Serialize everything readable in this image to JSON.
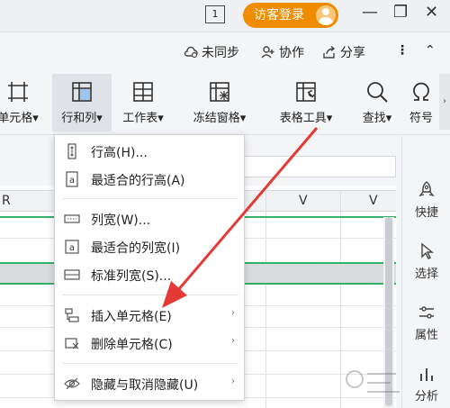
{
  "titlebar": {
    "box_label": "1",
    "visitor_label": "访客登录",
    "minimize": "—",
    "restore": "❐",
    "close": "✕"
  },
  "collab": {
    "sync_label": "未同步",
    "collab_label": "协作",
    "share_label": "分享",
    "more": "⋮",
    "collapse": "⌃"
  },
  "ribbon": {
    "items": [
      {
        "label": "单元格"
      },
      {
        "label": "行和列"
      },
      {
        "label": "工作表"
      },
      {
        "label": "冻结窗格"
      },
      {
        "label": "表格工具"
      },
      {
        "label": "查找"
      },
      {
        "label": "符号"
      }
    ],
    "scroll_right": "›"
  },
  "sheet": {
    "col_headers": [
      "R",
      "V",
      "V"
    ]
  },
  "menu": {
    "items": [
      {
        "label": "行高(H)..."
      },
      {
        "label": "最适合的行高(A)"
      },
      {
        "label": "列宽(W)..."
      },
      {
        "label": "最适合的列宽(I)"
      },
      {
        "label": "标准列宽(S)..."
      },
      {
        "label": "插入单元格(E)"
      },
      {
        "label": "删除单元格(C)"
      },
      {
        "label": "隐藏与取消隐藏(U)"
      }
    ],
    "submenu_arrow": "›"
  },
  "right_panel": {
    "items": [
      {
        "label": "快捷"
      },
      {
        "label": "选择"
      },
      {
        "label": "属性"
      },
      {
        "label": "分析"
      }
    ]
  },
  "colors": {
    "accent": "#f08c00",
    "arrow": "#e53935",
    "selection_green": "#34b16a"
  }
}
